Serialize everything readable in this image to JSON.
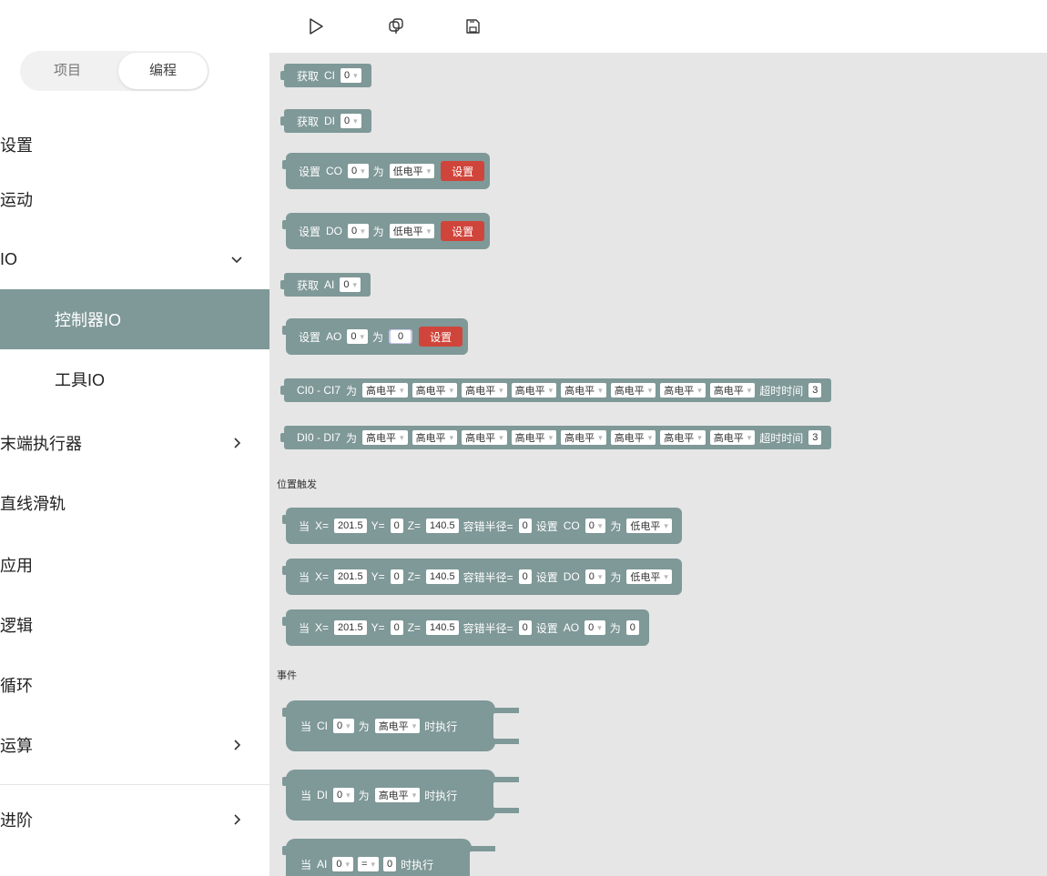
{
  "tabs": {
    "left": "项目",
    "right": "编程"
  },
  "nav": [
    {
      "label": "设置",
      "chevron": ""
    },
    {
      "label": "运动",
      "chevron": ""
    },
    {
      "label": "IO",
      "chevron": "down"
    },
    {
      "label": "控制器IO",
      "chevron": "",
      "active": true,
      "sub": true
    },
    {
      "label": "工具IO",
      "chevron": "",
      "sub": true
    },
    {
      "label": "末端执行器",
      "chevron": "right"
    },
    {
      "label": "直线滑轨",
      "chevron": ""
    },
    {
      "label": "应用",
      "chevron": ""
    },
    {
      "label": "逻辑",
      "chevron": ""
    },
    {
      "label": "循环",
      "chevron": ""
    },
    {
      "label": "运算",
      "chevron": "right"
    },
    {
      "label": "进阶",
      "chevron": "right"
    }
  ],
  "toolbar": {
    "run_icon": "play-icon",
    "debug_icon": "debug-icon",
    "save_icon": "save-icon"
  },
  "colors": {
    "block": "#7f9898",
    "set_button": "#d0453b",
    "workspace": "#e6e6e6",
    "active_nav": "#7f9898"
  },
  "blocks": {
    "get_ci": {
      "kw": "获取",
      "port": "CI",
      "value": "0"
    },
    "get_di": {
      "kw": "获取",
      "port": "DI",
      "value": "0"
    },
    "set_co": {
      "kw": "设置",
      "port": "CO",
      "value": "0",
      "as": "为",
      "level": "低电平",
      "btn": "设置"
    },
    "set_do": {
      "kw": "设置",
      "port": "DO",
      "value": "0",
      "as": "为",
      "level": "低电平",
      "btn": "设置"
    },
    "get_ai": {
      "kw": "获取",
      "port": "AI",
      "value": "0"
    },
    "set_ao": {
      "kw": "设置",
      "port": "AO",
      "value": "0",
      "as": "为",
      "num": "0",
      "btn": "设置"
    },
    "ci_range": {
      "label": "CI0 - CI7",
      "as": "为",
      "levels": [
        "高电平",
        "高电平",
        "高电平",
        "高电平",
        "高电平",
        "高电平",
        "高电平",
        "高电平"
      ],
      "timeout": "超时时间",
      "timeout_val": "3"
    },
    "di_range": {
      "label": "DI0 - DI7",
      "as": "为",
      "levels": [
        "高电平",
        "高电平",
        "高电平",
        "高电平",
        "高电平",
        "高电平",
        "高电平",
        "高电平"
      ],
      "timeout": "超时时间",
      "timeout_val": "3"
    },
    "pos_section": "位置触发",
    "pos1": {
      "when": "当",
      "x": "201.5",
      "y": "0",
      "z": "140.5",
      "radius_label": "容错半径=",
      "radius": "0",
      "set": "设置",
      "port": "CO",
      "pv": "0",
      "as": "为",
      "level": "低电平"
    },
    "pos2": {
      "when": "当",
      "x": "201.5",
      "y": "0",
      "z": "140.5",
      "radius_label": "容错半径=",
      "radius": "0",
      "set": "设置",
      "port": "DO",
      "pv": "0",
      "as": "为",
      "level": "低电平"
    },
    "pos3": {
      "when": "当",
      "x": "201.5",
      "y": "0",
      "z": "140.5",
      "radius_label": "容错半径=",
      "radius": "0",
      "set": "设置",
      "port": "AO",
      "pv": "0",
      "as": "为",
      "num": "0"
    },
    "event_section": "事件",
    "ev1": {
      "when": "当",
      "port": "CI",
      "pv": "0",
      "as": "为",
      "level": "高电平",
      "exec": "时执行"
    },
    "ev2": {
      "when": "当",
      "port": "DI",
      "pv": "0",
      "as": "为",
      "level": "高电平",
      "exec": "时执行"
    },
    "ev3": {
      "when": "当",
      "port": "AI",
      "pv": "0",
      "op": "=",
      "num": "0",
      "exec": "时执行"
    }
  }
}
